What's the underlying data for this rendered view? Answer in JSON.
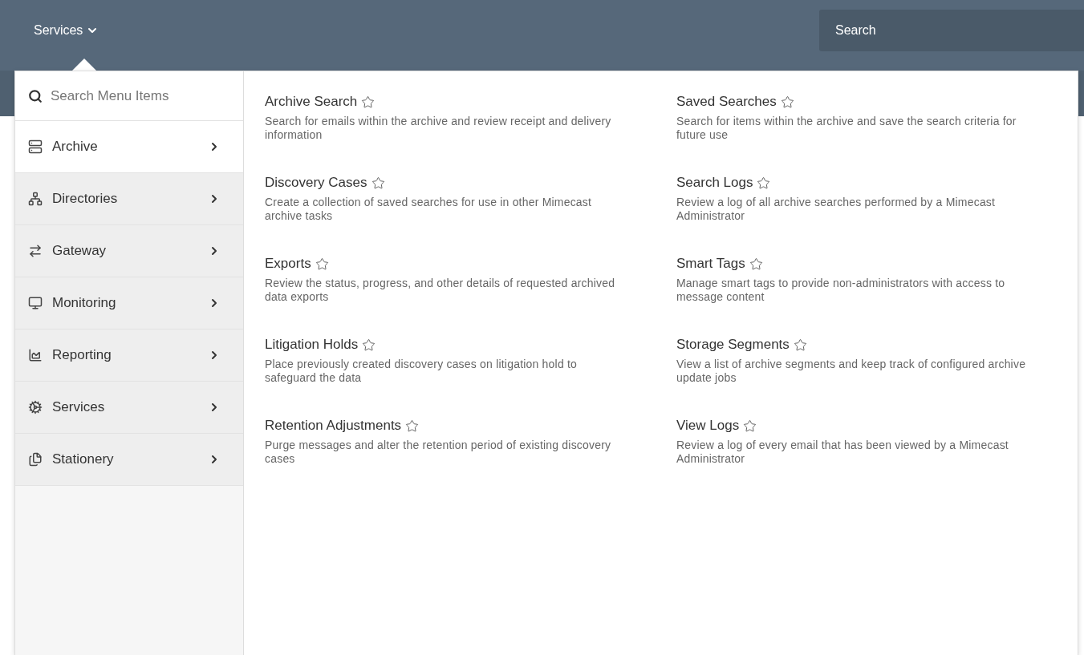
{
  "navbar": {
    "menu_label": "Services",
    "search": {
      "placeholder": "Search"
    }
  },
  "menu": {
    "search": {
      "placeholder": "Search Menu Items"
    },
    "sidebar": {
      "items": [
        {
          "label": "Archive",
          "selected": true
        },
        {
          "label": "Directories",
          "selected": false
        },
        {
          "label": "Gateway",
          "selected": false
        },
        {
          "label": "Monitoring",
          "selected": false
        },
        {
          "label": "Reporting",
          "selected": false
        },
        {
          "label": "Services",
          "selected": false
        },
        {
          "label": "Stationery",
          "selected": false
        }
      ]
    },
    "entries": [
      {
        "title": "Archive Search",
        "description": "Search for emails within the archive and review receipt and delivery information"
      },
      {
        "title": "Saved Searches",
        "description": "Search for items within the archive and save the search criteria for future use"
      },
      {
        "title": "Discovery Cases",
        "description": "Create a collection of saved searches for use in other Mimecast archive tasks"
      },
      {
        "title": "Search Logs",
        "description": "Review a log of all archive searches performed by a Mimecast Administrator"
      },
      {
        "title": "Exports",
        "description": "Review the status, progress, and other details of requested archived data exports"
      },
      {
        "title": "Smart Tags",
        "description": "Manage smart tags to provide non-administrators with access to message content"
      },
      {
        "title": "Litigation Holds",
        "description": "Place previously created discovery cases on litigation hold to safeguard the data"
      },
      {
        "title": "Storage Segments",
        "description": "View a list of archive segments and keep track of configured archive update jobs"
      },
      {
        "title": "Retention Adjustments",
        "description": "Purge messages and alter the retention period of existing discovery cases"
      },
      {
        "title": "View Logs",
        "description": "Review a log of every email that has been viewed by a Mimecast Administrator"
      }
    ]
  }
}
